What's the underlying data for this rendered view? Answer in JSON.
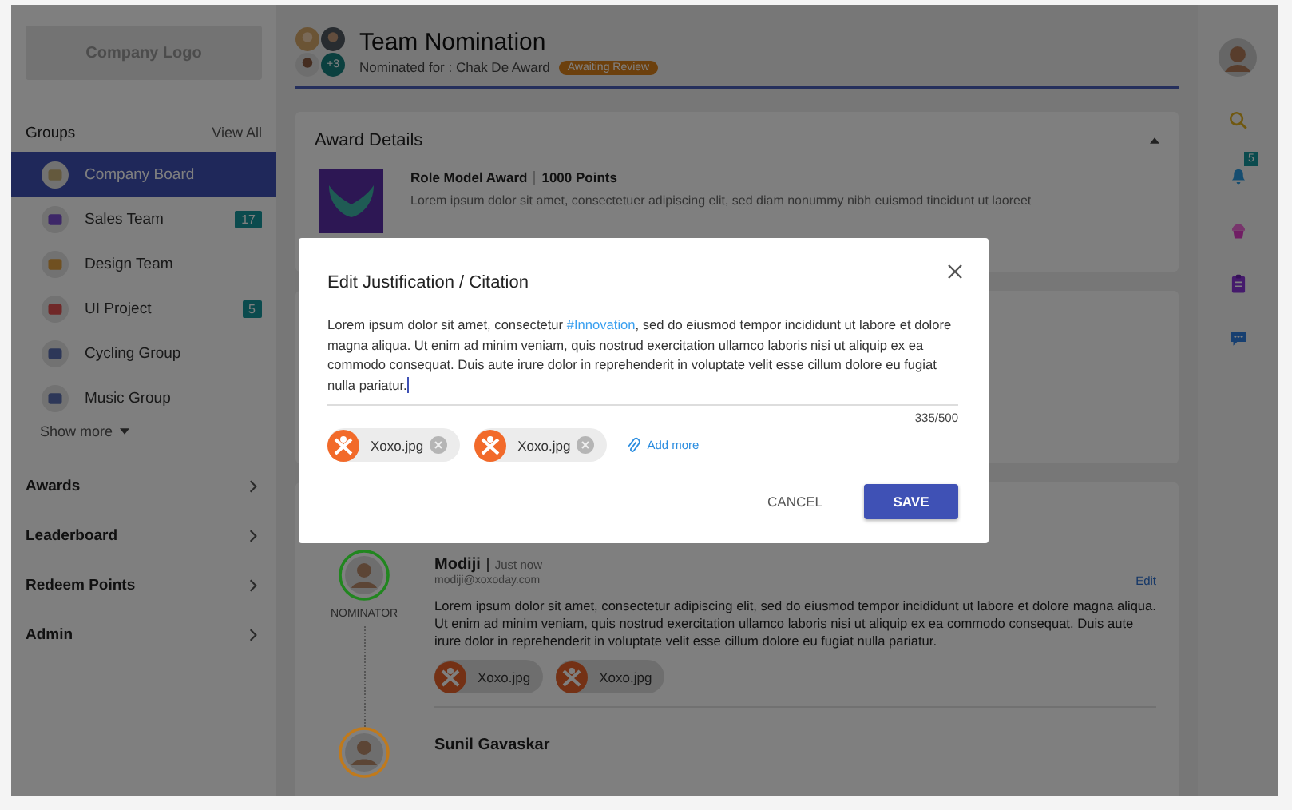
{
  "sidebar": {
    "logo": "Company Logo",
    "groups_title": "Groups",
    "view_all": "View All",
    "groups": [
      {
        "name": "Company Board",
        "selected": true
      },
      {
        "name": "Sales Team",
        "selected": false,
        "badge": "17"
      },
      {
        "name": "Design Team",
        "selected": false
      },
      {
        "name": "UI Project",
        "selected": false,
        "badge": "5"
      },
      {
        "name": "Cycling Group",
        "selected": false
      },
      {
        "name": "Music Group",
        "selected": false
      }
    ],
    "show_more": "Show more",
    "nav": [
      "Awards",
      "Leaderboard",
      "Redeem Points",
      "Admin"
    ]
  },
  "header": {
    "title": "Team Nomination",
    "extra_count": "+3",
    "subtitle": "Nominated for : Chak De Award",
    "status": "Awaiting Review"
  },
  "award_card": {
    "title": "Award Details",
    "award_name": "Role Model Award",
    "points": "1000 Points",
    "description": "Lorem ipsum dolor sit amet, consectetuer adipiscing elit, sed diam nonummy nibh euismod tincidunt ut laoreet"
  },
  "timeline": [
    {
      "name": "Modiji",
      "time": "Just now",
      "email": "modiji@xoxoday.com",
      "role": "NOMINATOR",
      "edit": "Edit",
      "color": "#21861f",
      "text": "Lorem ipsum dolor sit amet, consectetur adipiscing elit, sed do eiusmod tempor incididunt ut labore et dolore magna aliqua. Ut enim ad minim veniam, quis nostrud exercitation ullamco laboris nisi ut aliquip ex ea commodo consequat. Duis aute irure dolor in reprehenderit in voluptate velit esse cillum dolore eu fugiat nulla pariatur.",
      "attachments": [
        "Xoxo.jpg",
        "Xoxo.jpg"
      ]
    },
    {
      "name": "Sunil Gavaskar",
      "color": "#c07a1c"
    }
  ],
  "right_rail": {
    "notification_count": "5"
  },
  "modal": {
    "title": "Edit Justification / Citation",
    "text_before": "Lorem ipsum dolor sit amet, consectetur ",
    "hashtag": "#Innovation",
    "text_after": ", sed do eiusmod tempor incididunt ut labore et dolore magna aliqua. Ut enim ad minim veniam, quis nostrud exercitation ullamco laboris nisi ut aliquip ex ea commodo consequat. Duis aute irure dolor in reprehenderit in voluptate velit esse cillum dolore eu fugiat nulla pariatur.",
    "counter": "335/500",
    "attachments": [
      "Xoxo.jpg",
      "Xoxo.jpg"
    ],
    "add_more": "Add more",
    "cancel": "CANCEL",
    "save": "SAVE"
  }
}
